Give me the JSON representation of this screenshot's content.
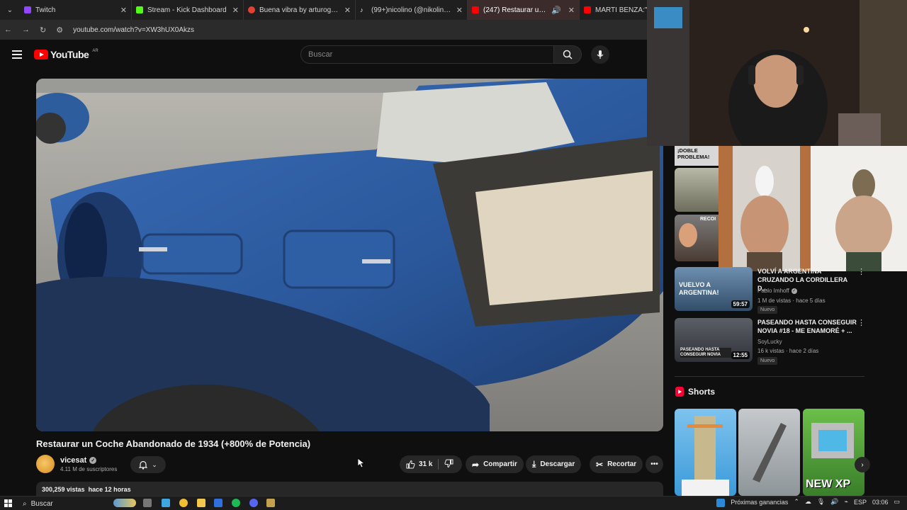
{
  "browser": {
    "tabs": [
      {
        "label": "Twitch",
        "color": "#9146ff",
        "active": false
      },
      {
        "label": "Stream - Kick Dashboard",
        "color": "#53fc18",
        "active": false
      },
      {
        "label": "Buena vibra by arturogaeldelec",
        "color": "#e34133",
        "active": false
      },
      {
        "label": "(99+)nicolino (@nikolinoo) | Ti",
        "color": "#ffffff",
        "active": false
      },
      {
        "label": "(247) Restaurar un Coche A",
        "color": "#ff0000",
        "active": true
      },
      {
        "label": "MARTI BENZA:\"Me q",
        "color": "#ff0000",
        "active": false
      }
    ],
    "url": "youtube.com/watch?v=XW3hUX0Akzs"
  },
  "header": {
    "logo_text": "YouTube",
    "country_code": "AR",
    "search_placeholder": "Buscar"
  },
  "video": {
    "title": "Restaurar un Coche Abandonado de 1934 (+800% de Potencia)",
    "channel": "vicesat",
    "subscribers": "4.11 M de suscriptores",
    "likes": "31 k",
    "share_label": "Compartir",
    "download_label": "Descargar",
    "clip_label": "Recortar",
    "views": "300,259 vistas",
    "age": "hace 12 horas"
  },
  "sidebar": {
    "thumb_texts": {
      "doble_problema": "¡DOBLE PROBLEMA!",
      "recoil": "RECOI"
    },
    "recommendations": [
      {
        "title": "VOLVÍ A ARGENTINA CRUZANDO LA CORDILLERA D...",
        "channel": "Pablo Imhoff",
        "meta": "1 M de vistas · hace 5 días",
        "badge": "Nuevo",
        "duration": "59:57",
        "thumb_text": "VUELVO A ARGENTINA!"
      },
      {
        "title": "PASEANDO HASTA CONSEGUIR NOVIA #18 - ME ENAMORÉ + ...",
        "channel": "SoyLucky",
        "meta": "16 k vistas · hace 2 días",
        "badge": "Nuevo",
        "duration": "12:55",
        "thumb_text": "PASEANDO HASTA CONSEGUIR NOVIA"
      }
    ],
    "shorts_title": "Shorts",
    "shorts_overlay": "NEW XP"
  },
  "taskbar": {
    "search_label": "Buscar",
    "weather_label": "Próximas ganancias",
    "language": "ESP",
    "time": "03:06"
  }
}
